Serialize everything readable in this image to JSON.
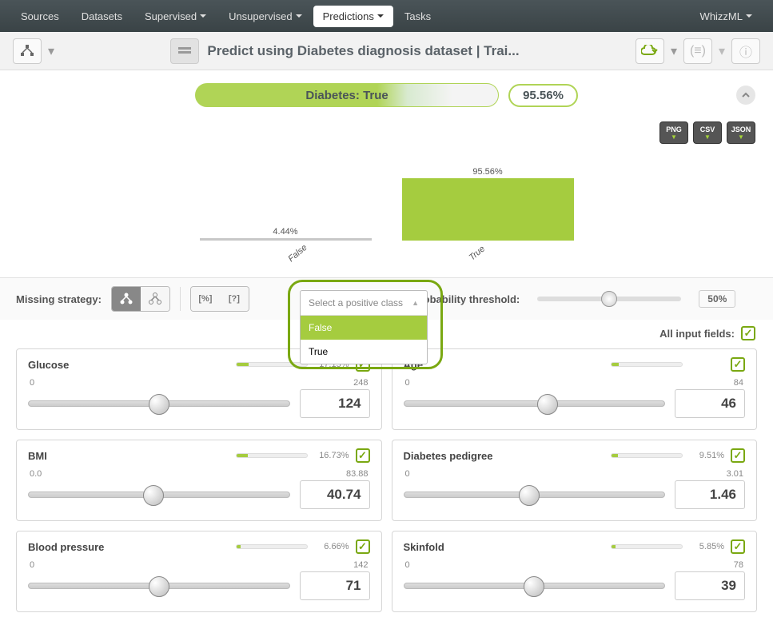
{
  "nav": {
    "items": [
      "Sources",
      "Datasets",
      "Supervised",
      "Unsupervised",
      "Predictions",
      "Tasks"
    ],
    "active_index": 4,
    "right_item": "WhizzML"
  },
  "page_title": "Predict using Diabetes diagnosis dataset | Trai...",
  "prediction": {
    "label": "Diabetes: True",
    "percent": "95.56%"
  },
  "exports": [
    "PNG",
    "CSV",
    "JSON"
  ],
  "chart_data": {
    "type": "bar",
    "title": "",
    "xlabel": "",
    "ylabel": "",
    "ylim": [
      0,
      100
    ],
    "categories": [
      "False",
      "True"
    ],
    "values": [
      4.44,
      95.56
    ],
    "value_labels": [
      "4.44%",
      "95.56%"
    ]
  },
  "controls": {
    "missing_label": "Missing strategy:",
    "threshold_label": "Probability threshold:",
    "threshold_value": "50%",
    "select_placeholder": "Select a positive class",
    "select_options": [
      "False",
      "True"
    ],
    "select_highlight_index": 0,
    "all_input_fields": "All input fields:"
  },
  "fields": [
    {
      "name": "Glucose",
      "min": "0",
      "max": "248",
      "value": "124",
      "pct": "17.15%",
      "fill": 17.15,
      "pos": 50
    },
    {
      "name": "Age",
      "min": "0",
      "max": "84",
      "value": "46",
      "pct": "",
      "fill": 10,
      "pos": 55
    },
    {
      "name": "BMI",
      "min": "0.0",
      "max": "83.88",
      "value": "40.74",
      "pct": "16.73%",
      "fill": 16.73,
      "pos": 48
    },
    {
      "name": "Diabetes pedigree",
      "min": "0",
      "max": "3.01",
      "value": "1.46",
      "pct": "9.51%",
      "fill": 9.51,
      "pos": 48
    },
    {
      "name": "Blood pressure",
      "min": "0",
      "max": "142",
      "value": "71",
      "pct": "6.66%",
      "fill": 6.66,
      "pos": 50
    },
    {
      "name": "Skinfold",
      "min": "0",
      "max": "78",
      "value": "39",
      "pct": "5.85%",
      "fill": 5.85,
      "pos": 50
    }
  ]
}
